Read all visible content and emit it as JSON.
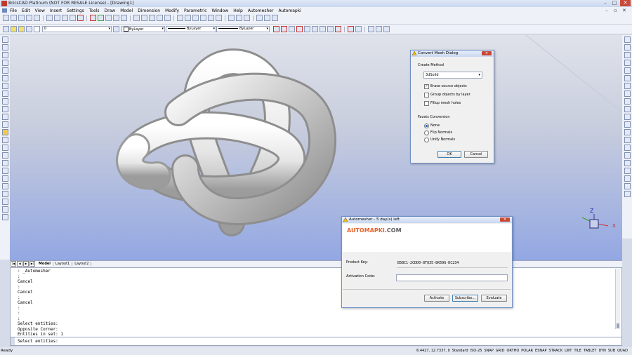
{
  "window": {
    "title": "BricsCAD Platinum (NOT FOR RESALE License) - [Drawing1]"
  },
  "menu": [
    "File",
    "Edit",
    "View",
    "Insert",
    "Settings",
    "Tools",
    "Draw",
    "Model",
    "Dimension",
    "Modify",
    "Parametric",
    "Window",
    "Help",
    "Automesher",
    "Automapki"
  ],
  "props_toolbar": {
    "layer": "0",
    "color": "ByLayer",
    "linetype": "ByLayer",
    "lineweight": "ByLayer"
  },
  "tabs": [
    "Model",
    "Layout1",
    "Layout2"
  ],
  "command_history": [
    ": _Automesher",
    ":",
    "Cancel",
    ":",
    "Cancel",
    ":",
    "Cancel",
    ":",
    ":",
    ":",
    "Select entities:",
    "Opposite Corner:",
    "Entities in set: 1"
  ],
  "prompt": "Select entities:",
  "status": {
    "ready": "Ready",
    "coords": "6.4427, 12.7337, 0",
    "style": "Standard",
    "dimstyle": "ISO-25",
    "toggles": [
      "SNAP",
      "GRID",
      "ORTHO",
      "POLAR",
      "ESNAP",
      "STRACK",
      "LWT",
      "TILE",
      "TABLET",
      "DYN",
      "SUB",
      "QUAD"
    ]
  },
  "convert_dialog": {
    "title": "Convert Mesh Dialog",
    "create_method_label": "Create Method",
    "create_method_value": "3dSolid",
    "options": [
      {
        "label": "Erase source objects",
        "checked": true
      },
      {
        "label": "Group objects by layer",
        "checked": false
      },
      {
        "label": "Fillup mesh holes",
        "checked": false
      }
    ],
    "facets_label": "Facets Conversion",
    "facets": [
      {
        "label": "None",
        "selected": true
      },
      {
        "label": "Flip Normals",
        "selected": false
      },
      {
        "label": "Unify Normals",
        "selected": false
      }
    ],
    "ok": "OK",
    "cancel": "Cancel"
  },
  "automesher_dialog": {
    "title": "Automesher - 5 day(s) left",
    "brand_a": "AUTOMAPKI",
    "brand_b": ".COM",
    "product_key_label": "Product Key:",
    "product_key": "B5BC1-2CDD0-8TQ35-8K59G-DC234",
    "activation_label": "Activation Code:",
    "activation_value": "",
    "activate": "Activate",
    "subscribe": "Subscribe...",
    "evaluate": "Evaluate"
  },
  "ucs": {
    "x": "X",
    "z": "Z"
  },
  "colors": {
    "brand_orange": "#e8622a",
    "brand_gray": "#5a5a5a",
    "titlebar": "#c9d7ee",
    "viewport_bottom": "#93a7e3"
  }
}
